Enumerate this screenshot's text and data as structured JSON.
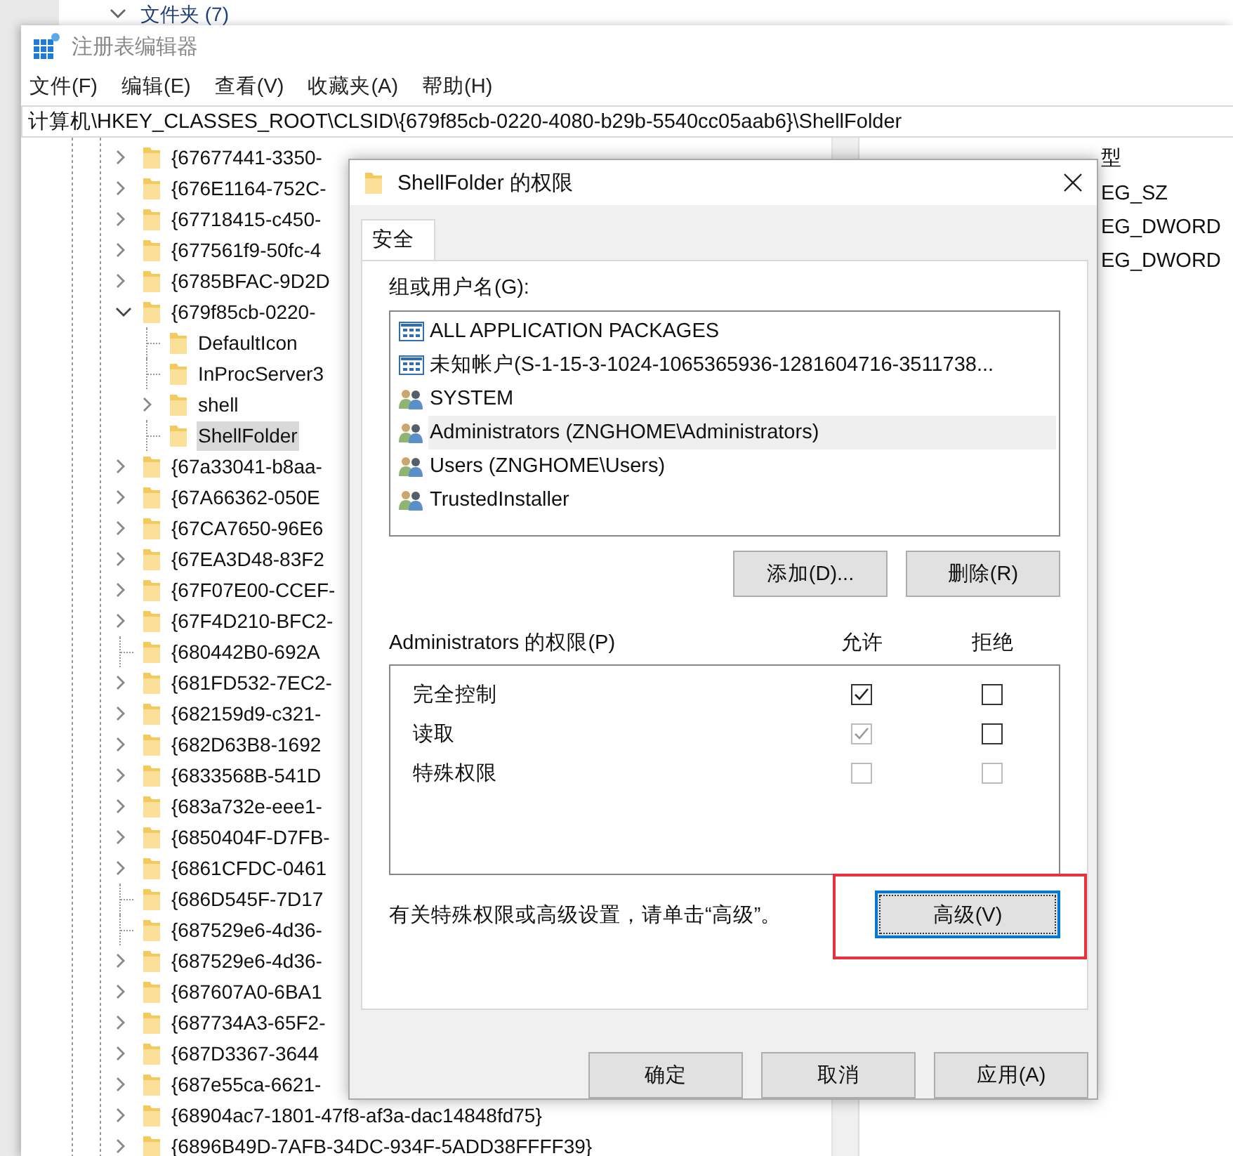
{
  "background": {
    "group_header": "文件夹 (7)"
  },
  "window": {
    "title": "注册表编辑器"
  },
  "menu": [
    "文件(F)",
    "编辑(E)",
    "查看(V)",
    "收藏夹(A)",
    "帮助(H)"
  ],
  "address": "计算机\\HKEY_CLASSES_ROOT\\CLSID\\{679f85cb-0220-4080-b29b-5540cc05aab6}\\ShellFolder",
  "tree": [
    {
      "kind": "collapsed",
      "label": "{67677441-3350-",
      "selected": false
    },
    {
      "kind": "collapsed",
      "label": "{676E1164-752C-",
      "selected": false
    },
    {
      "kind": "collapsed",
      "label": "{67718415-c450-",
      "selected": false
    },
    {
      "kind": "collapsed",
      "label": "{677561f9-50fc-4",
      "selected": false
    },
    {
      "kind": "collapsed",
      "label": "{6785BFAC-9D2D",
      "selected": false
    },
    {
      "kind": "expanded",
      "label": "{679f85cb-0220-",
      "selected": false,
      "children": [
        {
          "kind": "leaf",
          "label": "DefaultIcon",
          "selected": false
        },
        {
          "kind": "leaf",
          "label": "InProcServer3",
          "selected": false
        },
        {
          "kind": "collapsed",
          "label": "shell",
          "selected": false
        },
        {
          "kind": "leaf",
          "label": "ShellFolder",
          "selected": true
        }
      ]
    },
    {
      "kind": "collapsed",
      "label": "{67a33041-b8aa-",
      "selected": false
    },
    {
      "kind": "collapsed",
      "label": "{67A66362-050E",
      "selected": false
    },
    {
      "kind": "collapsed",
      "label": "{67CA7650-96E6",
      "selected": false
    },
    {
      "kind": "collapsed",
      "label": "{67EA3D48-83F2",
      "selected": false
    },
    {
      "kind": "collapsed",
      "label": "{67F07E00-CCEF-",
      "selected": false
    },
    {
      "kind": "collapsed",
      "label": "{67F4D210-BFC2-",
      "selected": false
    },
    {
      "kind": "leaf",
      "label": "{680442B0-692A",
      "selected": false
    },
    {
      "kind": "collapsed",
      "label": "{681FD532-7EC2-",
      "selected": false
    },
    {
      "kind": "collapsed",
      "label": "{682159d9-c321-",
      "selected": false
    },
    {
      "kind": "collapsed",
      "label": "{682D63B8-1692",
      "selected": false
    },
    {
      "kind": "collapsed",
      "label": "{6833568B-541D",
      "selected": false
    },
    {
      "kind": "collapsed",
      "label": "{683a732e-eee1-",
      "selected": false
    },
    {
      "kind": "collapsed",
      "label": "{6850404F-D7FB-",
      "selected": false
    },
    {
      "kind": "collapsed",
      "label": "{6861CFDC-0461",
      "selected": false
    },
    {
      "kind": "leaf",
      "label": "{686D545F-7D17",
      "selected": false
    },
    {
      "kind": "leaf",
      "label": "{687529e6-4d36-",
      "selected": false
    },
    {
      "kind": "collapsed",
      "label": "{687529e6-4d36-",
      "selected": false
    },
    {
      "kind": "collapsed",
      "label": "{687607A0-6BA1",
      "selected": false
    },
    {
      "kind": "collapsed",
      "label": "{687734A3-65F2-",
      "selected": false
    },
    {
      "kind": "collapsed",
      "label": "{687D3367-3644",
      "selected": false
    },
    {
      "kind": "collapsed",
      "label": "{687e55ca-6621-",
      "selected": false
    },
    {
      "kind": "collapsed",
      "label": "{68904ac7-1801-47f8-af3a-dac14848fd75}",
      "selected": false
    },
    {
      "kind": "collapsed",
      "label": "{6896B49D-7AFB-34DC-934F-5ADD38FFFF39}",
      "selected": false
    }
  ],
  "values_pane": {
    "column_header": "型",
    "rows": [
      "EG_SZ",
      "EG_DWORD",
      "EG_DWORD"
    ]
  },
  "dialog": {
    "title": "ShellFolder 的权限",
    "tabs": [
      {
        "label": "安全",
        "selected": true
      }
    ],
    "principals_label": "组或用户名(G):",
    "principals": [
      {
        "kind": "package",
        "name": "ALL APPLICATION PACKAGES",
        "selected": false
      },
      {
        "kind": "package",
        "name": "未知帐户(S-1-15-3-1024-1065365936-1281604716-3511738...",
        "selected": false
      },
      {
        "kind": "group",
        "name": "SYSTEM",
        "selected": false
      },
      {
        "kind": "group",
        "name": "Administrators (ZNGHOME\\Administrators)",
        "selected": true
      },
      {
        "kind": "group",
        "name": "Users (ZNGHOME\\Users)",
        "selected": false
      },
      {
        "kind": "group",
        "name": "TrustedInstaller",
        "selected": false
      }
    ],
    "list_buttons": [
      "添加(D)...",
      "删除(R)"
    ],
    "permissions_label": "Administrators 的权限(P)",
    "allow_header": "允许",
    "deny_header": "拒绝",
    "permissions": [
      {
        "name": "完全控制",
        "allow": {
          "checked": true,
          "disabled": false
        },
        "deny": {
          "checked": false,
          "disabled": false
        }
      },
      {
        "name": "读取",
        "allow": {
          "checked": true,
          "disabled": true
        },
        "deny": {
          "checked": false,
          "disabled": false
        }
      },
      {
        "name": "特殊权限",
        "allow": {
          "checked": false,
          "disabled": true
        },
        "deny": {
          "checked": false,
          "disabled": true
        }
      }
    ],
    "advanced_hint": "有关特殊权限或高级设置，请单击“高级”。",
    "advanced_button": {
      "label": "高级(V)",
      "focused": true,
      "highlighted": true
    },
    "footer_buttons": [
      "确定",
      "取消",
      "应用(A)"
    ]
  }
}
